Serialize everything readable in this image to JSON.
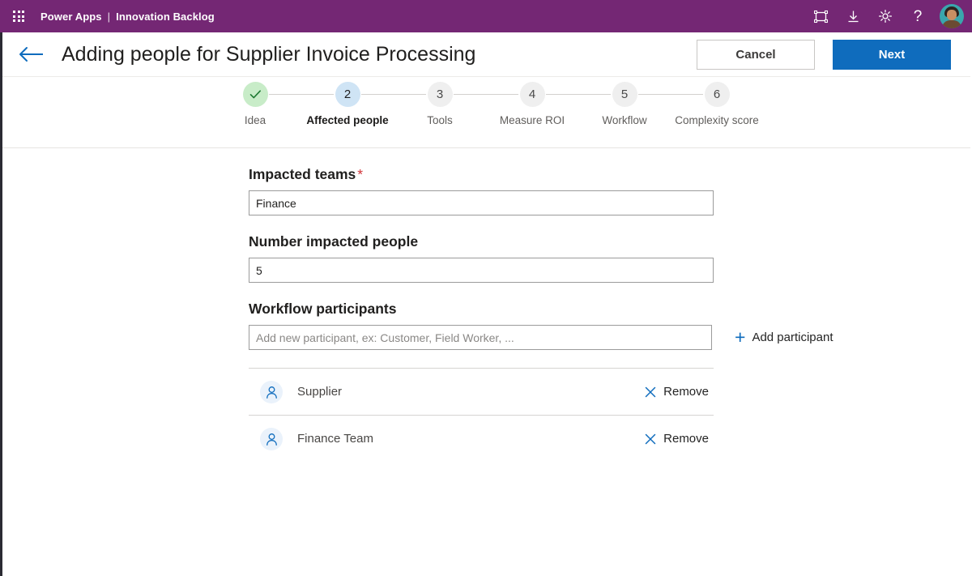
{
  "suite": {
    "waffle_icon": "app-launcher-grid-icon",
    "app_name": "Power Apps",
    "separator": "|",
    "environment": "Innovation Backlog",
    "actions": [
      {
        "name": "fullscreen-icon",
        "tooltip": "Fullscreen"
      },
      {
        "name": "download-icon",
        "tooltip": "Download"
      },
      {
        "name": "gear-icon",
        "tooltip": "Settings"
      },
      {
        "name": "help-icon",
        "glyph": "?",
        "tooltip": "Help"
      }
    ],
    "avatar_alt": "User account photo",
    "bar_color": "#742774"
  },
  "title_bar": {
    "back_icon": "back-arrow-icon",
    "title": "Adding people for Supplier Invoice Processing",
    "cancel_label": "Cancel",
    "next_label": "Next",
    "primary_color": "#0f6cbd"
  },
  "stepper": {
    "current_step": 2,
    "steps": [
      {
        "number": "1",
        "label": "Idea",
        "state": "done",
        "glyph": "✓"
      },
      {
        "number": "2",
        "label": "Affected people",
        "state": "active"
      },
      {
        "number": "3",
        "label": "Tools",
        "state": "pending"
      },
      {
        "number": "4",
        "label": "Measure ROI",
        "state": "pending"
      },
      {
        "number": "5",
        "label": "Workflow",
        "state": "pending"
      },
      {
        "number": "6",
        "label": "Complexity score",
        "state": "pending"
      }
    ],
    "done_color": "#c8ecc8",
    "active_color": "#cfe4f5",
    "pending_color": "#efefef"
  },
  "form": {
    "impacted_teams": {
      "label": "Impacted teams",
      "required_marker": "*",
      "value": "Finance",
      "placeholder": ""
    },
    "number_impacted_people": {
      "label": "Number impacted people",
      "value": "5",
      "placeholder": ""
    },
    "workflow_participants": {
      "label": "Workflow participants",
      "value": "",
      "placeholder": "Add new participant, ex: Customer, Field Worker, ...",
      "add_label": "Add participant",
      "add_icon": "plus-icon"
    }
  },
  "participants": [
    {
      "icon": "person-icon",
      "name": "Supplier",
      "remove_label": "Remove",
      "remove_icon": "close-x-icon"
    },
    {
      "icon": "person-icon",
      "name": "Finance Team",
      "remove_label": "Remove",
      "remove_icon": "close-x-icon"
    }
  ]
}
